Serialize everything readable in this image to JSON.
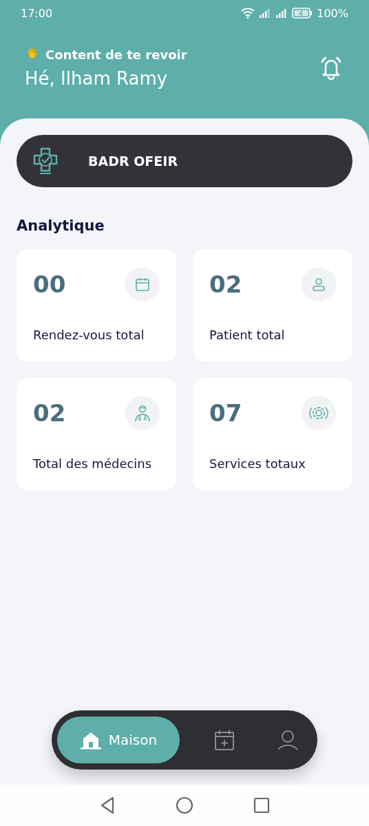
{
  "status_bar": {
    "time": "17:00",
    "battery": "100%"
  },
  "header": {
    "greeting": "Content de te revoir",
    "name": "Hé, Ilham Ramy"
  },
  "clinic": {
    "name": "BADR OFEIR"
  },
  "section_title": "Analytique",
  "stats": [
    {
      "value": "00",
      "label": "Rendez-vous total",
      "kind": "calendar"
    },
    {
      "value": "02",
      "label": "Patient total",
      "kind": "person"
    },
    {
      "value": "02",
      "label": "Total des médecins",
      "kind": "doctor"
    },
    {
      "value": "07",
      "label": "Services totaux",
      "kind": "gear"
    }
  ],
  "nav": [
    {
      "kind": "home",
      "label": "Maison",
      "selected": true
    },
    {
      "kind": "calendar",
      "selected": false
    },
    {
      "kind": "profile",
      "selected": false
    }
  ]
}
